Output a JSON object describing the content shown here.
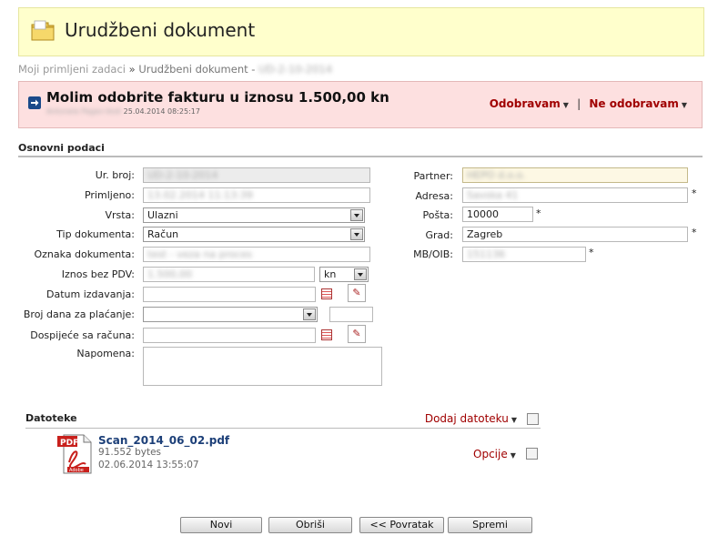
{
  "header": {
    "title": "Urudžbeni dokument"
  },
  "breadcrumb": {
    "parent": "Moji primljeni zadaci",
    "separator": "»",
    "current": "Urudžbeni dokument -",
    "doc_id": "UD-2-10-2014"
  },
  "alert": {
    "title": "Molim odobrite fakturu u iznosu 1.500,00 kn",
    "author": "Antonela Pagan-Vodi",
    "timestamp": "25.04.2014 08:25:17",
    "approve": "Odobravam",
    "divider": "|",
    "reject": "Ne odobravam"
  },
  "section_title": "Osnovni podaci",
  "form_left": {
    "ur_broj": {
      "label": "Ur. broj:",
      "value": "UD-2-10-2014"
    },
    "primljeno": {
      "label": "Primljeno:",
      "value": "13.02.2014 11:13:39"
    },
    "vrsta": {
      "label": "Vrsta:",
      "value": "Ulazni"
    },
    "tip": {
      "label": "Tip dokumenta:",
      "value": "Račun"
    },
    "oznaka": {
      "label": "Oznaka dokumenta:",
      "value": "test - veza na proces"
    },
    "iznos": {
      "label": "Iznos bez PDV:",
      "value": "1.500,00",
      "currency": "kn"
    },
    "datum": {
      "label": "Datum izdavanja:",
      "value": ""
    },
    "broj_dana": {
      "label": "Broj dana za plaćanje:",
      "value": "",
      "extra": ""
    },
    "dospijece": {
      "label": "Dospijeće sa računa:",
      "value": ""
    },
    "napomena": {
      "label": "Napomena:",
      "value": ""
    }
  },
  "form_right": {
    "partner": {
      "label": "Partner:",
      "value": "HEPO d.o.o."
    },
    "adresa": {
      "label": "Adresa:",
      "value": "Savska 41"
    },
    "posta": {
      "label": "Pošta:",
      "value": "10000"
    },
    "grad": {
      "label": "Grad:",
      "value": "Zagreb"
    },
    "mboib": {
      "label": "MB/OIB:",
      "value": "151136"
    }
  },
  "required_mark": "*",
  "files": {
    "title": "Datoteke",
    "add_label": "Dodaj datoteku",
    "items": [
      {
        "name": "Scan_2014_06_02.pdf",
        "size": "91.552 bytes",
        "date": "02.06.2014 13:55:07",
        "options": "Opcije"
      }
    ]
  },
  "buttons": {
    "new": "Novi",
    "delete": "Obriši",
    "back": "<< Povratak",
    "save": "Spremi"
  },
  "colors": {
    "title_bg": "#ffffcc",
    "alert_bg": "#fde0e0",
    "accent": "#a00000",
    "link": "#1c3f78"
  }
}
